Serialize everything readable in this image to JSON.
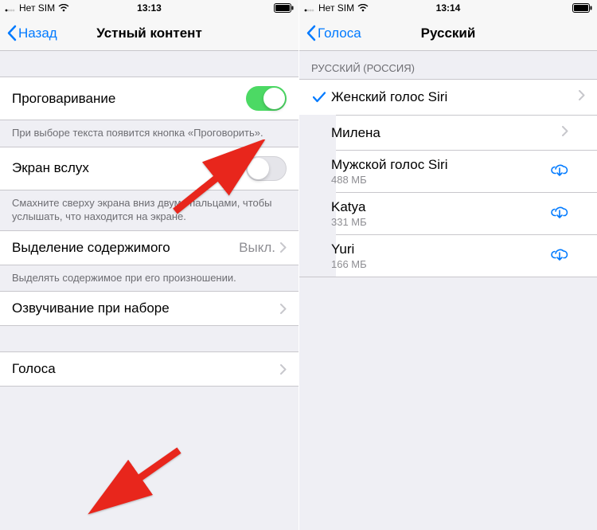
{
  "left": {
    "status": {
      "carrier": "Нет SIM",
      "time": "13:13"
    },
    "nav": {
      "back": "Назад",
      "title": "Устный контент"
    },
    "rows": {
      "speakSelection": {
        "label": "Проговаривание",
        "footer": "При выборе текста появится кнопка «Проговорить»."
      },
      "speakScreen": {
        "label": "Экран вслух",
        "footer": "Смахните сверху экрана вниз двумя пальцами, чтобы услышать, что находится на экране."
      },
      "highlight": {
        "label": "Выделение содержимого",
        "value": "Выкл.",
        "footer": "Выделять содержимое при его произношении."
      },
      "typingFeedback": {
        "label": "Озвучивание при наборе"
      },
      "voices": {
        "label": "Голоса"
      }
    }
  },
  "right": {
    "status": {
      "carrier": "Нет SIM",
      "time": "13:14"
    },
    "nav": {
      "back": "Голоса",
      "title": "Русский"
    },
    "sectionHeader": "РУССКИЙ (РОССИЯ)",
    "voices": [
      {
        "name": "Женский голос Siri",
        "selected": true,
        "chevron": true
      },
      {
        "name": "Милена",
        "chevron": true
      },
      {
        "name": "Мужской голос Siri",
        "size": "488 МБ",
        "download": true
      },
      {
        "name": "Katya",
        "size": "331 МБ",
        "download": true
      },
      {
        "name": "Yuri",
        "size": "166 МБ",
        "download": true
      }
    ]
  }
}
